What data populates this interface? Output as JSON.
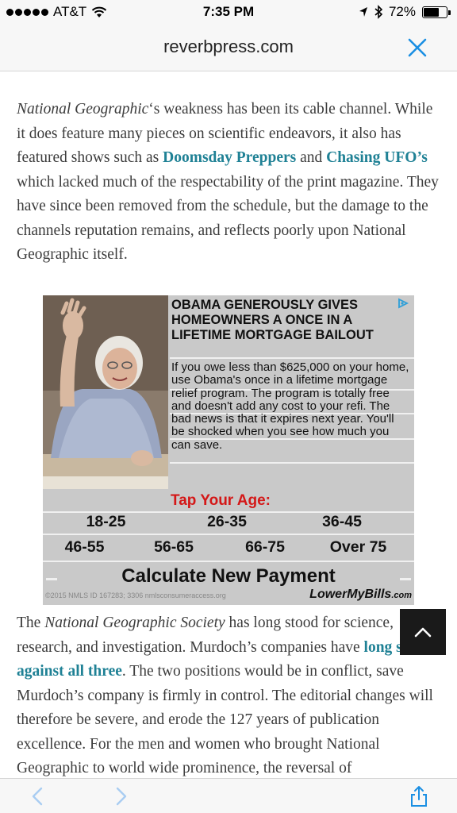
{
  "status_bar": {
    "carrier": "AT&T",
    "time": "7:35 PM",
    "battery": "72%",
    "battery_level": 0.72
  },
  "browser": {
    "domain": "reverbpress.com"
  },
  "article": {
    "para1": {
      "t1": "National Geographic",
      "t2": "‘s weakness has been its cable channel. While it does feature many pieces on scientific endeavors, it also has featured shows such as ",
      "link1": "Doomsday Preppers",
      "t3": " and ",
      "link2": "Chasing UFO’s",
      "t4": " which lacked much of the respectability of the print magazine. They have since been removed from the schedule, but the damage to the channels reputation remains, and reflects poorly upon National Geographic itself."
    },
    "para2": {
      "t1": "The ",
      "t2": "National Geographic Society",
      "t3": " has long stood for science, research, and investigation. Murdoch’s companies have ",
      "link1": "long stood against all three",
      "t4": ". The two positions would be in conflict, save Murdoch’s company is firmly in control. The editorial changes will therefore be severe, and erode the 127 years of publication excellence. For the men and women who brought National Geographic to world wide prominence, the reversal of"
    }
  },
  "ad": {
    "headline": "OBAMA GENEROUSLY GIVES HOMEOWNERS A ONCE IN A LIFETIME MORTGAGE BAILOUT",
    "body": "If you owe less than $625,000 on your home, use Obama's once in a lifetime mortgage relief program. The program is totally free and doesn't add any cost to your refi. The bad news is that it expires next year. You'll be shocked when you see how much you can save.",
    "age_title": "Tap Your Age:",
    "ages_row1": [
      "18-25",
      "26-35",
      "36-45"
    ],
    "ages_row2": [
      "46-55",
      "56-65",
      "66-75",
      "Over 75"
    ],
    "cta": "Calculate New Payment",
    "footer": "©2015 NMLS ID 167283; 3306 nmlsconsumeraccess.org",
    "brand": "LowerMyBills",
    "brand_suffix": ".com"
  },
  "colors": {
    "link": "#1f8195",
    "accent_blue": "#1a8fe3",
    "age_title": "#d41818"
  },
  "icons": [
    "wifi-icon",
    "location-arrow-icon",
    "bluetooth-icon",
    "battery-icon",
    "close-icon",
    "ad-choices-icon",
    "chevron-up-icon",
    "back-icon",
    "forward-icon",
    "share-icon"
  ]
}
